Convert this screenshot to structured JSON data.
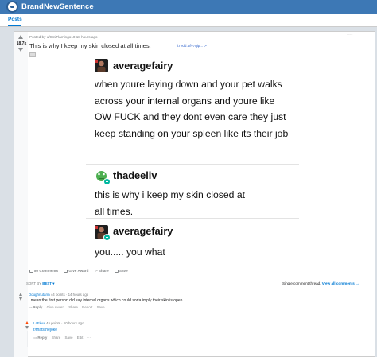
{
  "header": {
    "title": "BrandNewSentence"
  },
  "tabs": [
    {
      "label": "Posts"
    }
  ],
  "post": {
    "score": "18.7k",
    "meta": "Posted by u/SmiFlamingo10 18 hours ago",
    "title": "This is why I keep my skin closed at all times.",
    "link": "i.redd.it/lv7qip...",
    "sidebar_text": "...........",
    "tumblr": [
      {
        "name": "averagefairy",
        "body": "when youre laying down and your pet walks across your internal organs and youre like OW FUCK and they dont even care they just keep standing on your spleen like its their job"
      },
      {
        "name": "thadeeliv",
        "body": "this is why i keep my skin closed at all times."
      },
      {
        "name": "averagefairy",
        "body": "you..... you what"
      }
    ],
    "actions": [
      "80 Comments",
      "Give Award",
      "Share",
      "Save"
    ]
  },
  "sort": {
    "label": "SORT BY",
    "value": "BEST"
  },
  "thread_note": {
    "text": "Single comment thread.",
    "link": "View all comments →"
  },
  "comments": [
    {
      "user": "Doughnutarm",
      "points": "44 points",
      "time": "14 hours ago",
      "text": "I mean the first person did say internal organs which could sorta imply their skin is open",
      "actions": [
        "Reply",
        "Give Award",
        "Share",
        "Report",
        "Save"
      ]
    },
    {
      "user": "LaFleur",
      "points": "45 points",
      "time": "10 hours ago",
      "text": "r/thatsthejoke",
      "actions": [
        "Reply",
        "Share",
        "Save",
        "Edit",
        "···"
      ]
    }
  ],
  "colors": {
    "accent": "#0079d3",
    "banner": "#3d78b5",
    "reblog": "#00b8a0",
    "upvote": "#ff4500"
  }
}
